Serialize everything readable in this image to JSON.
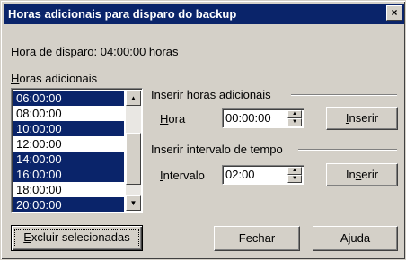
{
  "window": {
    "title": "Horas adicionais para disparo do backup",
    "close_symbol": "×"
  },
  "trigger": {
    "label": "Hora de disparo: 04:00:00 horas"
  },
  "additional_hours": {
    "label_mnemonic": "H",
    "label_rest": "oras adicionais",
    "items": [
      {
        "time": "06:00:00",
        "selected": true
      },
      {
        "time": "08:00:00",
        "selected": false
      },
      {
        "time": "10:00:00",
        "selected": true
      },
      {
        "time": "12:00:00",
        "selected": false
      },
      {
        "time": "14:00:00",
        "selected": true
      },
      {
        "time": "16:00:00",
        "selected": true
      },
      {
        "time": "18:00:00",
        "selected": false
      },
      {
        "time": "20:00:00",
        "selected": true
      }
    ]
  },
  "insert_hours_group": {
    "title": "Inserir horas adicionais",
    "field_mnemonic": "H",
    "field_rest": "ora",
    "value": "00:00:00",
    "button_mnemonic": "I",
    "button_rest": "nserir"
  },
  "insert_interval_group": {
    "title": "Inserir intervalo de tempo",
    "field_mnemonic": "I",
    "field_rest": "ntervalo",
    "value": "02:00",
    "button_pre": "In",
    "button_mnemonic": "s",
    "button_post": "erir"
  },
  "buttons": {
    "delete_mnemonic": "E",
    "delete_rest": "xcluir selecionadas",
    "close": "Fechar",
    "help": "Ajuda"
  },
  "icons": {
    "scroll_up": "▲",
    "scroll_down": "▼",
    "spin_up": "▲",
    "spin_down": "▼"
  }
}
